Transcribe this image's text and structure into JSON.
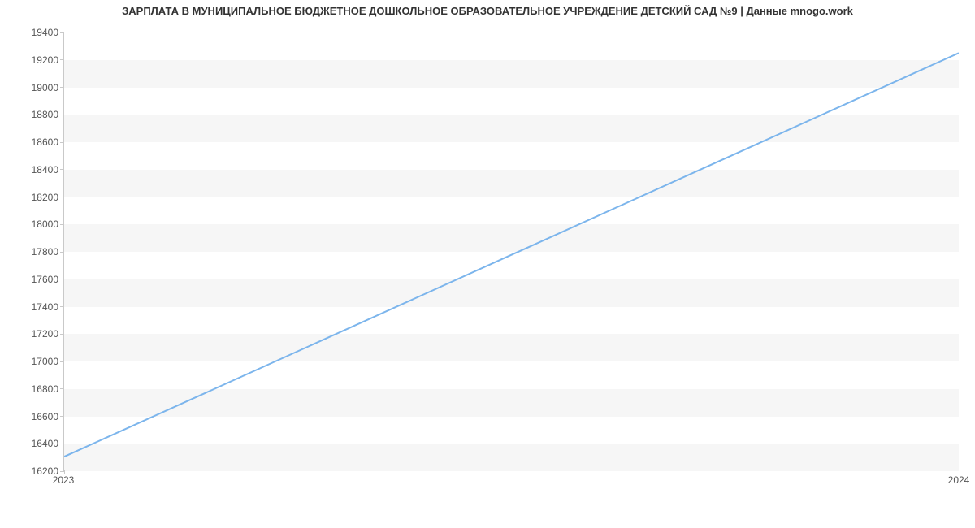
{
  "chart_data": {
    "type": "line",
    "title": "ЗАРПЛАТА В МУНИЦИПАЛЬНОЕ БЮДЖЕТНОЕ ДОШКОЛЬНОЕ ОБРАЗОВАТЕЛЬНОЕ УЧРЕЖДЕНИЕ ДЕТСКИЙ САД №9 | Данные mnogo.work",
    "x": [
      2023,
      2024
    ],
    "values": [
      16300,
      19250
    ],
    "xlabel": "",
    "ylabel": "",
    "x_ticks": [
      2023,
      2024
    ],
    "y_ticks": [
      16200,
      16400,
      16600,
      16800,
      17000,
      17200,
      17400,
      17600,
      17800,
      18000,
      18200,
      18400,
      18600,
      18800,
      19000,
      19200,
      19400
    ],
    "xlim": [
      2023,
      2024
    ],
    "ylim": [
      16200,
      19400
    ],
    "line_color": "#7cb5ec"
  }
}
